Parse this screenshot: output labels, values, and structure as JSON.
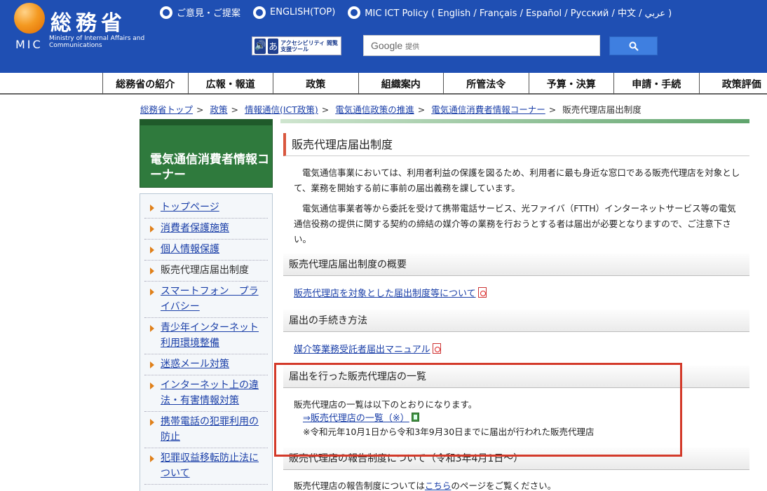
{
  "header": {
    "logo_jp": "総務省",
    "logo_mic": "MIC",
    "logo_sub": "Ministry of Internal Affairs and Communications",
    "top_links": [
      "ご意見・ご提案",
      "ENGLISH(TOP)",
      "MIC ICT Policy ( English / Français / Español / Русский / 中文 / عربي )"
    ],
    "a11y_text": "アクセシビリティ 閲覧支援ツール",
    "search_brand": "Google",
    "search_sub": "提供"
  },
  "nav": [
    "総務省の紹介",
    "広報・報道",
    "政策",
    "組織案内",
    "所管法令",
    "予算・決算",
    "申請・手続",
    "政策評価"
  ],
  "breadcrumb": [
    "総務省トップ",
    "政策",
    "情報通信(ICT政策)",
    "電気通信政策の推進",
    "電気通信消費者情報コーナー",
    "販売代理店届出制度"
  ],
  "sidebar": {
    "title": "電気通信消費者情報コーナー",
    "items": [
      {
        "label": "トップページ"
      },
      {
        "label": "消費者保護施策"
      },
      {
        "label": "個人情報保護"
      },
      {
        "label": "販売代理店届出制度"
      },
      {
        "label": "スマートフォン　プライバシー"
      },
      {
        "label": "青少年インターネット利用環境整備"
      },
      {
        "label": "迷惑メール対策"
      },
      {
        "label": "インターネット上の違法・有害情報対策"
      },
      {
        "label": "携帯電話の犯罪利用の防止"
      },
      {
        "label": "犯罪収益移転防止法について"
      }
    ]
  },
  "main": {
    "title": "販売代理店届出制度",
    "para1": "電気通信事業においては、利用者利益の保護を図るため、利用者に最も身近な窓口である販売代理店を対象として、業務を開始する前に事前の届出義務を課しています。",
    "para2": "電気通信事業者等から委託を受けて携帯電話サービス、光ファイバ（FTTH）インターネットサービス等の電気通信役務の提供に関する契約の締結の媒介等の業務を行おうとする者は届出が必要となりますので、ご注意下さい。",
    "section1": "販売代理店届出制度の概要",
    "link1": "販売代理店を対象とした届出制度等について",
    "section2": "届出の手続き方法",
    "link2": "媒介等業務受託者届出マニュアル",
    "section3": "届出を行った販売代理店の一覧",
    "s3_text": "販売代理店の一覧は以下のとおりになります。",
    "s3_link": "⇒販売代理店の一覧（※）",
    "s3_note": "※令和元年10月1日から令和3年9月30日までに届出が行われた販売代理店",
    "section4": "販売代理店の報告制度について（令和3年4月1日〜）",
    "s4_text_pre": "販売代理店の報告制度については",
    "s4_link": "こちら",
    "s4_text_post": "のページをご覧ください。"
  }
}
